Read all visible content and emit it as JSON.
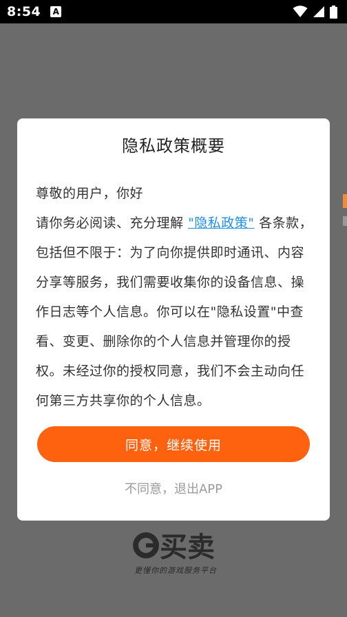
{
  "status_bar": {
    "time": "8:54",
    "notification_letter": "A"
  },
  "dialog": {
    "title": "隐私政策概要",
    "greeting": "尊敬的用户，你好",
    "body": {
      "line1_before": "请你务必阅读、充分理解",
      "link_text": "\"隐私政策\"",
      "line1_after": "各条款，",
      "line2": "包括但不限于：为了向你提供即时通讯、内容",
      "line3": "分享等服务，我们需要收集你的设备信息、操",
      "line4": "作日志等个人信息。你可以在\"隐私设置\"中查",
      "line5": "看、变更、删除你的个人信息并管理你的授",
      "line6": "权。未经过你的授权同意，我们不会主动向任",
      "line7": "何第三方共享你的个人信息。"
    },
    "agree_label": "同意，继续使用",
    "decline_label": "不同意，退出APP"
  },
  "background": {
    "brand_logo_text": "G买卖",
    "brand_tagline": "更懂你的游戏服务平台"
  },
  "colors": {
    "accent": "#ff620e",
    "link": "#1f8ee8",
    "overlay": "#6b6b6b"
  },
  "icons": [
    "wifi-icon",
    "signal-icon",
    "battery-icon"
  ]
}
